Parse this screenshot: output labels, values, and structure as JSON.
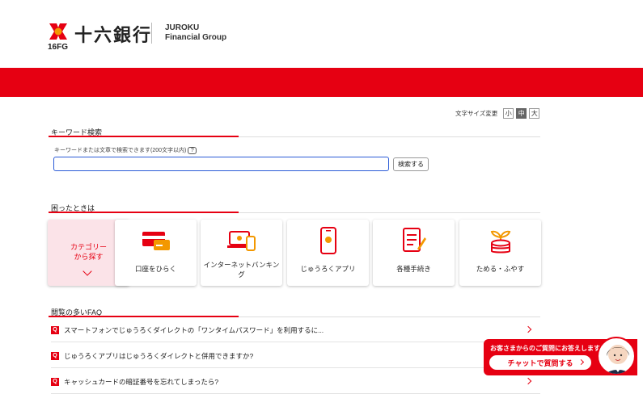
{
  "header": {
    "logo_name": "十六銀行",
    "logo_sub": "16FG",
    "group_line1": "JUROKU",
    "group_line2": "Financial Group"
  },
  "font_size": {
    "label": "文字サイズ変更",
    "options": [
      "小",
      "中",
      "大"
    ],
    "selected": "中"
  },
  "keyword_search": {
    "title": "キーワード検索",
    "hint": "キーワードまたは文章で検索できます(200文字以内)",
    "help": "?",
    "value": "",
    "placeholder": "",
    "button": "検索する"
  },
  "help_section": {
    "title": "困ったときは",
    "category_card": {
      "line1": "カテゴリー",
      "line2": "から探す"
    },
    "cards": [
      {
        "label": "口座をひらく",
        "icon": "card-icon"
      },
      {
        "label": "インターネットバンキング",
        "icon": "laptop-phone-icon"
      },
      {
        "label": "じゅうろくアプリ",
        "icon": "smartphone-icon"
      },
      {
        "label": "各種手続き",
        "icon": "document-pen-icon"
      },
      {
        "label": "ためる・ふやす",
        "icon": "coin-sprout-icon"
      }
    ]
  },
  "faq": {
    "title": "閲覧の多いFAQ",
    "badge": "Q",
    "items": [
      "スマートフォンでじゅうろくダイレクトの「ワンタイムパスワード」を利用するに...",
      "じゅうろくアプリはじゅうろくダイレクトと併用できますか?",
      "キャッシュカードの暗証番号を忘れてしまったら?"
    ]
  },
  "chat": {
    "caption": "お客さまからのご質問にお答えします",
    "button": "チャットで質問する"
  },
  "colors": {
    "brand_red": "#e60012",
    "accent_orange": "#f39800",
    "category_bg": "#fbe3e8",
    "input_border": "#2b5bd7"
  }
}
